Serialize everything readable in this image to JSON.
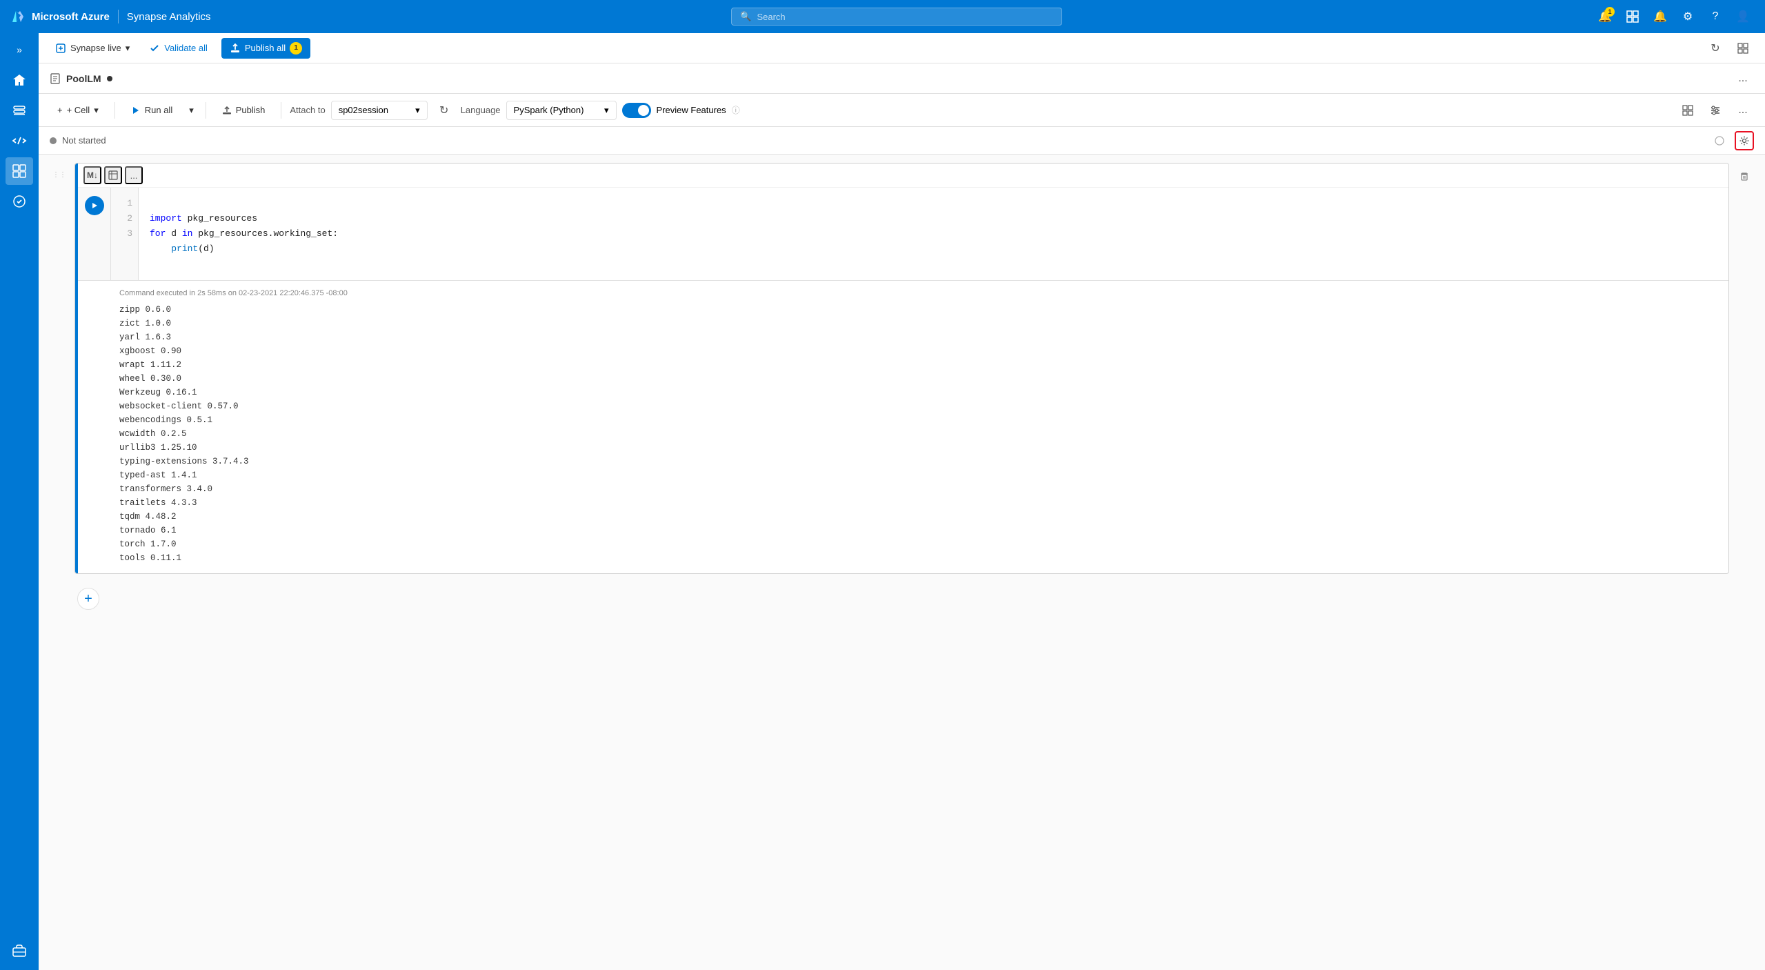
{
  "topnav": {
    "brand": "Microsoft Azure",
    "divider": "|",
    "app": "Synapse Analytics",
    "search_placeholder": "Search",
    "icons": {
      "notifications": "🔔",
      "notifications_badge": "1",
      "switch_directory": "⊞",
      "gear": "⚙",
      "help": "?",
      "user": "👤",
      "refresh": "↻",
      "feedback": "☰"
    }
  },
  "secondary_toolbar": {
    "synapse_live_label": "Synapse live",
    "validate_all_label": "Validate all",
    "publish_all_label": "Publish all",
    "publish_all_badge": "1",
    "refresh_icon": "↻",
    "icon2": "⊞"
  },
  "notebook": {
    "title": "PoolLM",
    "unsaved": true,
    "more_options": "...",
    "toolbar": {
      "cell_btn": "+ Cell",
      "run_all_btn": "Run all",
      "chevron": "▾",
      "publish_btn": "Publish",
      "attach_to_label": "Attach to",
      "attach_value": "sp02session",
      "refresh_icon": "↻",
      "language_label": "Language",
      "language_value": "PySpark (Python)",
      "preview_features_label": "Preview Features",
      "info_icon": "ⓘ",
      "nb_icon1": "⊞",
      "nb_icon2": "≡",
      "nb_more": "..."
    },
    "status": {
      "text": "Not started",
      "icon1": "⊙",
      "icon2": "⚙"
    },
    "cell": {
      "md_btn": "M↓",
      "table_icon": "⊞",
      "more_icon": "...",
      "line1": "1",
      "line2": "2",
      "line3": "3",
      "code_line1": "import pkg_resources",
      "code_line2": "for d in pkg_resources.working_set:",
      "code_line3": "    print(d)",
      "exec_info": "Command executed in 2s 58ms on 02-23-2021 22:20:46.375 -08:00",
      "output": "zipp 0.6.0\nzict 1.0.0\nyarl 1.6.3\nxgboost 0.90\nwrapt 1.11.2\nwheel 0.30.0\nWerkzeug 0.16.1\nwebsocket-client 0.57.0\nwebencodings 0.5.1\nwcwidth 0.2.5\nurllib3 1.25.10\ntyping-extensions 3.7.4.3\ntyped-ast 1.4.1\ntransformers 3.4.0\ntraitlets 4.3.3\ntqdm 4.48.2\ntornado 6.1\ntorch 1.7.0\ntools 0.11.1"
    }
  }
}
